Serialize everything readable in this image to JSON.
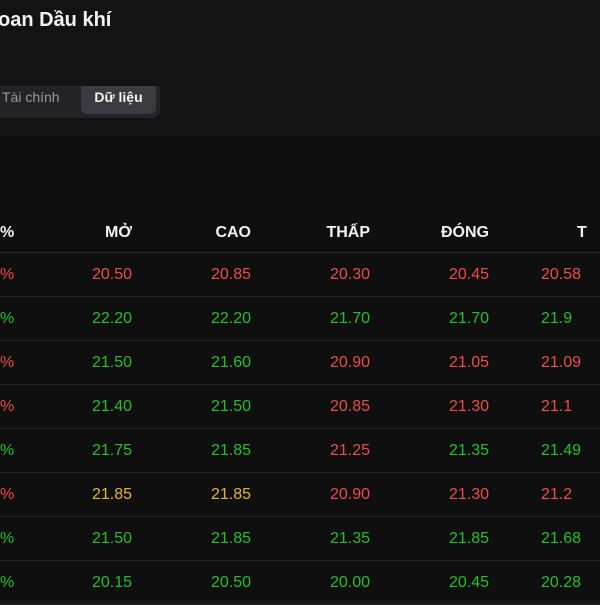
{
  "header": {
    "title": "oan Dầu khí"
  },
  "tabs": [
    {
      "label": "Tài chính",
      "active": false
    },
    {
      "label": "Dữ liệu",
      "active": true
    }
  ],
  "table": {
    "columns": [
      "%",
      "MỞ",
      "CAO",
      "THẤP",
      "ĐÓNG",
      "T"
    ],
    "rows": [
      {
        "pct": "%",
        "pct_color": "down",
        "open": "20.50",
        "open_color": "down",
        "high": "20.85",
        "high_color": "down",
        "low": "20.30",
        "low_color": "down",
        "close": "20.45",
        "close_color": "down",
        "t": "20.58",
        "t_color": "down"
      },
      {
        "pct": "%",
        "pct_color": "up",
        "open": "22.20",
        "open_color": "up",
        "high": "22.20",
        "high_color": "up",
        "low": "21.70",
        "low_color": "up",
        "close": "21.70",
        "close_color": "up",
        "t": "21.9",
        "t_color": "up"
      },
      {
        "pct": "%",
        "pct_color": "down",
        "open": "21.50",
        "open_color": "up",
        "high": "21.60",
        "high_color": "up",
        "low": "20.90",
        "low_color": "down",
        "close": "21.05",
        "close_color": "down",
        "t": "21.09",
        "t_color": "down"
      },
      {
        "pct": "%",
        "pct_color": "down",
        "open": "21.40",
        "open_color": "up",
        "high": "21.50",
        "high_color": "up",
        "low": "20.85",
        "low_color": "down",
        "close": "21.30",
        "close_color": "down",
        "t": "21.1",
        "t_color": "down"
      },
      {
        "pct": "%",
        "pct_color": "up",
        "open": "21.75",
        "open_color": "up",
        "high": "21.85",
        "high_color": "up",
        "low": "21.25",
        "low_color": "down",
        "close": "21.35",
        "close_color": "up",
        "t": "21.49",
        "t_color": "up"
      },
      {
        "pct": "%",
        "pct_color": "down",
        "open": "21.85",
        "open_color": "ref",
        "high": "21.85",
        "high_color": "ref",
        "low": "20.90",
        "low_color": "down",
        "close": "21.30",
        "close_color": "down",
        "t": "21.2",
        "t_color": "down"
      },
      {
        "pct": "%",
        "pct_color": "up",
        "open": "21.50",
        "open_color": "up",
        "high": "21.85",
        "high_color": "up",
        "low": "21.35",
        "low_color": "up",
        "close": "21.85",
        "close_color": "up",
        "t": "21.68",
        "t_color": "up"
      },
      {
        "pct": "%",
        "pct_color": "up",
        "open": "20.15",
        "open_color": "up",
        "high": "20.50",
        "high_color": "up",
        "low": "20.00",
        "low_color": "up",
        "close": "20.45",
        "close_color": "up",
        "t": "20.28",
        "t_color": "up"
      }
    ]
  },
  "colors": {
    "up": "#22c02b",
    "down": "#f04a4a",
    "ref": "#e3b42c",
    "background": "#0f0f0f"
  }
}
